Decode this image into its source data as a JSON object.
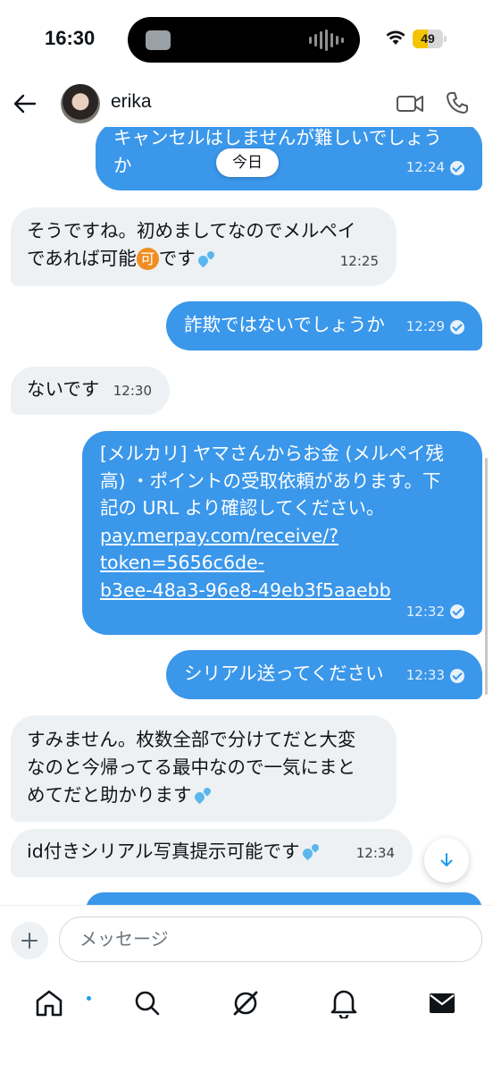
{
  "status_bar": {
    "time": "16:30",
    "battery": "49",
    "battery_level": 0.49,
    "battery_color": "#f5c400"
  },
  "header": {
    "contact_name": "erika",
    "back_icon": "arrow-left-icon",
    "video_icon": "video-camera-icon",
    "phone_icon": "phone-icon"
  },
  "chat": {
    "date_label": "今日",
    "messages": [
      {
        "side": "sent",
        "lines": [
          "キャンセルはしませんが難しいでしょう",
          "か"
        ],
        "time": "12:24"
      },
      {
        "side": "recv",
        "lines": [
          "そうですね。初めましてなのでメルペイ",
          "であれば可能",
          "です"
        ],
        "badge": "可",
        "time": "12:25"
      },
      {
        "side": "sent",
        "text": "詐欺ではないでしょうか",
        "time": "12:29"
      },
      {
        "side": "recv",
        "text": "ないです",
        "time": "12:30"
      },
      {
        "side": "sent",
        "lines": [
          "[メルカリ] ヤマさんからお金 (メルペイ残",
          "高) ・ポイントの受取依頼があります。下",
          "記の URL より確認してください。"
        ],
        "link_lines": [
          "pay.merpay.com/receive/?",
          "token=5656c6de-",
          "b3ee-48a3-96e8-49eb3f5aaebb"
        ],
        "time": "12:32"
      },
      {
        "side": "sent",
        "text": "シリアル送ってください",
        "time": "12:33"
      },
      {
        "side": "recv",
        "lines": [
          "すみません。枚数全部で分けてだと大変",
          "なのと今帰ってる最中なので一気にまと",
          "めてだと助かります"
        ]
      },
      {
        "side": "recv",
        "text": "id付きシリアル写真提示可能です",
        "time": "12:34"
      }
    ]
  },
  "composer": {
    "placeholder": "メッセージ"
  },
  "colors": {
    "sent_bubble": "#3a97ea",
    "received_bubble": "#eef1f3",
    "accent": "#1d9bf0"
  },
  "nav": [
    "home-icon",
    "search-icon",
    "grok-icon",
    "bell-icon",
    "mail-icon"
  ]
}
